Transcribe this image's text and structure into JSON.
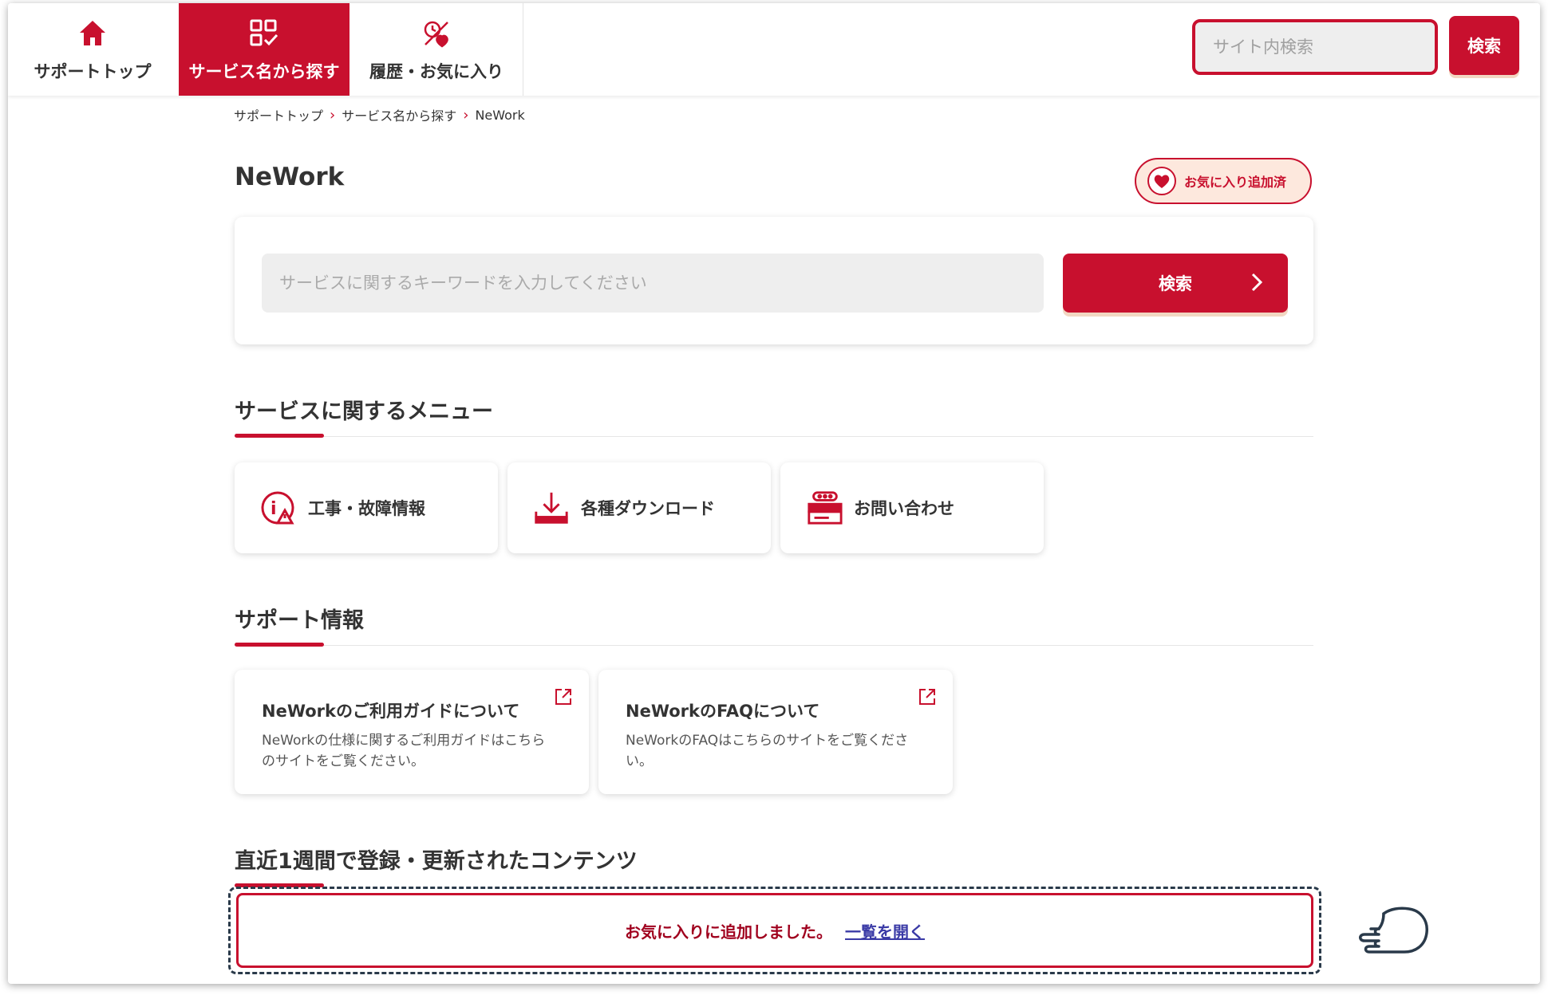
{
  "header": {
    "nav": [
      {
        "label": "サポートトップ",
        "icon": "home-icon"
      },
      {
        "label": "サービス名から探す",
        "icon": "service-grid-icon"
      },
      {
        "label": "履歴・お気に入り",
        "icon": "history-favorite-icon"
      }
    ],
    "search_placeholder": "サイト内検索",
    "search_button": "検索"
  },
  "breadcrumb": [
    "サポートトップ",
    "サービス名から探す",
    "NeWork"
  ],
  "page_title": "NeWork",
  "favorite_badge": "お気に入り追加済",
  "service_search": {
    "placeholder": "サービスに関するキーワードを入力してください",
    "button": "検索"
  },
  "sections": {
    "menu": "サービスに関するメニュー",
    "support": "サポート情報",
    "recent": "直近1週間で登録・更新されたコンテンツ"
  },
  "menu_cards": [
    {
      "label": "工事・故障情報",
      "icon": "maintenance-info-icon"
    },
    {
      "label": "各種ダウンロード",
      "icon": "download-icon"
    },
    {
      "label": "お問い合わせ",
      "icon": "contact-icon"
    }
  ],
  "support_cards": [
    {
      "title": "NeWorkのご利用ガイドについて",
      "desc": "NeWorkの仕様に関するご利用ガイドはこちらのサイトをご覧ください。"
    },
    {
      "title": "NeWorkのFAQについて",
      "desc": "NeWorkのFAQはこちらのサイトをご覧ください。"
    }
  ],
  "toast": {
    "message": "お気に入りに追加しました。",
    "link": "一覧を開く"
  },
  "colors": {
    "brand": "#c8102e",
    "badge_bg": "#fde8dd",
    "button_shadow": "#f2d7c2"
  }
}
